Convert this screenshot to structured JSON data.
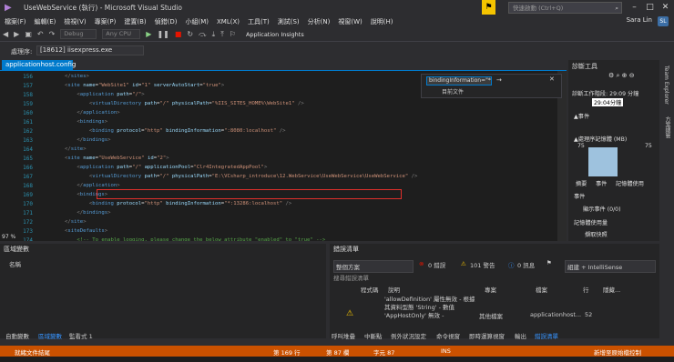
{
  "window": {
    "title": "UseWebService (執行) - Microsoft Visual Studio",
    "quick_launch_placeholder": "快速啟動 (Ctrl+Q)",
    "user": "Sara Lin",
    "avatar": "SL"
  },
  "menu": [
    "檔案(F)",
    "編輯(E)",
    "檢視(V)",
    "專案(P)",
    "建置(B)",
    "偵錯(D)",
    "小組(M)",
    "XML(X)",
    "工具(T)",
    "測試(S)",
    "分析(N)",
    "視窗(W)",
    "說明(H)"
  ],
  "toolbar": {
    "config": "Debug",
    "platform": "Any CPU",
    "app_insights": "Application Insights",
    "process_label": "處理序:",
    "process": "[18612] iisexpress.exe"
  },
  "editor": {
    "tab": "applicationhost.config",
    "zoom": "97 %",
    "find": {
      "value": "bindingInformation=\"*",
      "scope": "目前文件"
    },
    "lines": [
      {
        "n": "156",
        "html": "        <span class=\"p\">&lt;/</span><span class=\"t\">sites</span><span class=\"p\">&gt;</span>"
      },
      {
        "n": "157",
        "html": "        <span class=\"p\">&lt;</span><span class=\"t\">site</span> <span class=\"a\">name</span>=<span class=\"s\">\"WebSite1\"</span> <span class=\"a\">id</span>=<span class=\"s\">\"1\"</span> <span class=\"a\">serverAutoStart</span>=<span class=\"s\">\"true\"</span><span class=\"p\">&gt;</span>"
      },
      {
        "n": "158",
        "html": "            <span class=\"p\">&lt;</span><span class=\"t\">application</span> <span class=\"a\">path</span>=<span class=\"s\">\"/\"</span><span class=\"p\">&gt;</span>"
      },
      {
        "n": "159",
        "html": "                <span class=\"p\">&lt;</span><span class=\"t\">virtualDirectory</span> <span class=\"a\">path</span>=<span class=\"s\">\"/\"</span> <span class=\"a\">physicalPath</span>=<span class=\"s\">\"%IIS_SITES_HOME%\\WebSite1\"</span> <span class=\"p\">/&gt;</span>"
      },
      {
        "n": "160",
        "html": "            <span class=\"p\">&lt;/</span><span class=\"t\">application</span><span class=\"p\">&gt;</span>"
      },
      {
        "n": "161",
        "html": "            <span class=\"p\">&lt;</span><span class=\"t\">bindings</span><span class=\"p\">&gt;</span>"
      },
      {
        "n": "162",
        "html": "                <span class=\"p\">&lt;</span><span class=\"t\">binding</span> <span class=\"a\">protocol</span>=<span class=\"s\">\"http\"</span> <span class=\"a\">bindingInformation</span>=<span class=\"s\">\":8080:localhost\"</span> <span class=\"p\">/&gt;</span>"
      },
      {
        "n": "163",
        "html": "            <span class=\"p\">&lt;/</span><span class=\"t\">bindings</span><span class=\"p\">&gt;</span>"
      },
      {
        "n": "164",
        "html": "        <span class=\"p\">&lt;/</span><span class=\"t\">site</span><span class=\"p\">&gt;</span>"
      },
      {
        "n": "165",
        "html": "        <span class=\"p\">&lt;</span><span class=\"t\">site</span> <span class=\"a\">name</span>=<span class=\"s\">\"UseWebService\"</span> <span class=\"a\">id</span>=<span class=\"s\">\"2\"</span><span class=\"p\">&gt;</span>"
      },
      {
        "n": "166",
        "html": "            <span class=\"p\">&lt;</span><span class=\"t\">application</span> <span class=\"a\">path</span>=<span class=\"s\">\"/\"</span> <span class=\"a\">applicationPool</span>=<span class=\"s\">\"Clr4IntegratedAppPool\"</span><span class=\"p\">&gt;</span>"
      },
      {
        "n": "167",
        "html": "                <span class=\"p\">&lt;</span><span class=\"t\">virtualDirectory</span> <span class=\"a\">path</span>=<span class=\"s\">\"/\"</span> <span class=\"a\">physicalPath</span>=<span class=\"s\">\"E:\\VCsharp_introduce\\12.WebService\\UseWebService\\UseWebService\"</span> <span class=\"p\">/&gt;</span>"
      },
      {
        "n": "168",
        "html": "            <span class=\"p\">&lt;/</span><span class=\"t\">application</span><span class=\"p\">&gt;</span>"
      },
      {
        "n": "169",
        "html": "            <span class=\"p\">&lt;</span><span class=\"t\">bindings</span><span class=\"p\">&gt;</span>"
      },
      {
        "n": "170",
        "html": "                <span class=\"p\">&lt;</span><span class=\"t\">binding</span> <span class=\"a\">protocol</span>=<span class=\"s\">\"http\"</span> <span class=\"a\">bindingInformation</span>=<span class=\"s\">\"*:13286:localhost\"</span> <span class=\"p\">/&gt;</span>"
      },
      {
        "n": "171",
        "html": "            <span class=\"p\">&lt;/</span><span class=\"t\">bindings</span><span class=\"p\">&gt;</span>"
      },
      {
        "n": "172",
        "html": "        <span class=\"p\">&lt;/</span><span class=\"t\">site</span><span class=\"p\">&gt;</span>"
      },
      {
        "n": "173",
        "html": "        <span class=\"p\">&lt;</span><span class=\"t\">siteDefaults</span><span class=\"p\">&gt;</span>"
      },
      {
        "n": "174",
        "html": "            <span class=\"c\">&lt;!-- To enable logging, please change the below attribute \"enabled\" to \"true\" --&gt;</span>"
      }
    ]
  },
  "diagnostics": {
    "title": "診斷工具",
    "session": "診斷工作階段: 29:09 分鐘",
    "session_mark": "29:04分鐘",
    "events": "▲事件",
    "memory": "▲處理序記憶體 (MB)",
    "mem_left": "75",
    "mem_right": "75",
    "tabs": [
      "摘要",
      "事件",
      "記憶體使用"
    ],
    "events_section": "事件",
    "show_events": "顯示事件 (0/0)",
    "memory_usage": "記憶體使用量",
    "snapshot": "擷取快照"
  },
  "side_tabs": [
    "Team Explorer",
    "方案總管"
  ],
  "locals": {
    "title": "區域變數",
    "col_name": "名稱",
    "tabs": [
      "自動變數",
      "區域變數",
      "監看式 1"
    ]
  },
  "errors": {
    "title": "錯誤清單",
    "scope": "整個方案",
    "err": "0 錯誤",
    "warn": "101 警告",
    "msg": "0 訊息",
    "build": "組建 + IntelliSense",
    "search": "搜尋錯誤清單",
    "cols": [
      "程式碼",
      "說明",
      "專案",
      "檔案",
      "行",
      "隱藏..."
    ],
    "row": {
      "desc": "'allowDefinition' 屬性無效 - 根據其資料型態 'String' - 數值 'AppHostOnly' 無效 -",
      "project": "其他檔案",
      "file": "applicationhost...",
      "line": "52"
    },
    "tabs": [
      "呼叫堆疊",
      "中斷點",
      "例外狀況設定",
      "命令視窗",
      "即時運算視窗",
      "輸出",
      "錯誤清單"
    ]
  },
  "status": {
    "left": "就緒文件結尾",
    "line": "第 169 行",
    "col": "第 87 欄",
    "ch": "字元 87",
    "ins": "INS",
    "source_control": "新增至原始檔控制"
  },
  "colors": {
    "accent": "#007acc",
    "status": "#ca5100",
    "highlight": "#e0302b"
  }
}
